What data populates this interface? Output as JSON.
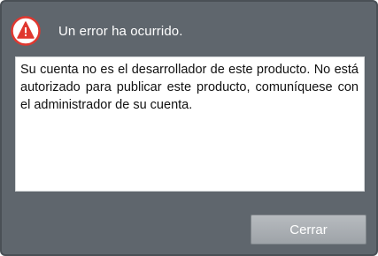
{
  "dialog": {
    "title": "Un error ha ocurrido.",
    "icon": "warning-triangle-icon",
    "message": "Su cuenta no es el desarrollador de este producto. No está autorizado para publicar este producto, comuníquese con el administrador de su cuenta.",
    "close_label": "Cerrar"
  },
  "colors": {
    "dialog_background": "#5f666d",
    "icon_red": "#e0372f",
    "button_background": "#a9adb1"
  }
}
